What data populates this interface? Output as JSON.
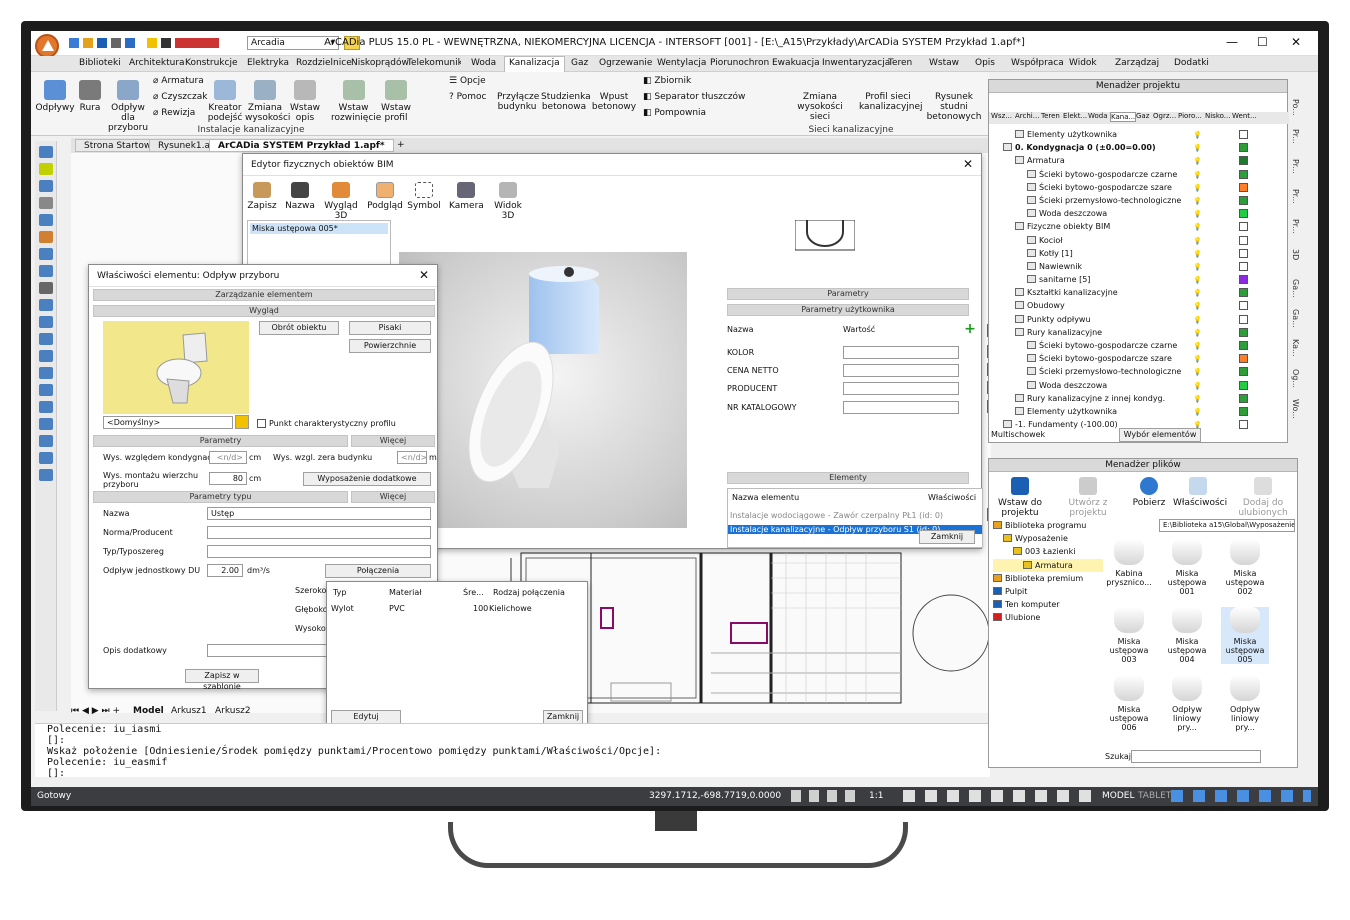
{
  "window": {
    "title": "ArCADia PLUS 15.0 PL - WEWNĘTRZNA, NIEKOMERCYJNA LICENCJA - INTERSOFT [001] - [E:\\_A15\\Przykłady\\ArCADia SYSTEM Przykład 1.apf*]",
    "profile": "Arcadia"
  },
  "menu": [
    "Biblioteki",
    "Architektura",
    "Konstrukcje",
    "Elektryka",
    "Rozdzielnice",
    "Niskoprądów",
    "Telekomunikacja",
    "Woda",
    "Kanalizacja",
    "Gaz",
    "Ogrzewanie",
    "Wentylacja",
    "Piorunochron",
    "Ewakuacja",
    "Inwentaryzacja",
    "Teren",
    "Wstaw",
    "Opis",
    "Współpraca",
    "Widok",
    "Zarządzaj",
    "Dodatki"
  ],
  "ribbon": {
    "buttons": [
      "Odpływy",
      "Rura",
      "Odpływ dla przyboru",
      "Kreator podejść",
      "Zmiana wysokości",
      "Wstaw opis",
      "Wstaw rozwinięcie",
      "Wstaw profil",
      "Przyłącze budynku",
      "Studzienka betonowa",
      "Wpust betonowy",
      "Zmiana wysokości sieci",
      "Profil sieci kanalizacyjnej",
      "Rysunek studni betonowych"
    ],
    "small": [
      "Armatura",
      "Czyszczak",
      "Rewizja",
      "Opcje",
      "Pomoc",
      "Zbiornik",
      "Separator tłuszczów",
      "Pompownia"
    ],
    "groups": [
      "Instalacje kanalizacyjne",
      "Sieci kanalizacyjne"
    ]
  },
  "doc_tabs": [
    "Strona Startowa",
    "Rysunek1.apf",
    "ArCADia SYSTEM Przykład 1.apf*"
  ],
  "bim_editor": {
    "title": "Edytor fizycznych obiektów BIM",
    "toolbar": [
      "Zapisz",
      "Nazwa",
      "Wygląd 3D",
      "Podgląd",
      "Symbol",
      "Kamera",
      "Widok 3D"
    ],
    "list_item": "Miska ustępowa 005*",
    "sections": {
      "params": "Parametry",
      "user_params": "Parametry użytkownika",
      "elements": "Elementy"
    },
    "cols": {
      "name": "Nazwa",
      "value": "Wartość"
    },
    "user_rows": [
      "KOLOR",
      "CENA NETTO",
      "PRODUCENT",
      "NR KATALOGOWY"
    ],
    "elem_cols": {
      "name": "Nazwa elementu",
      "props": "Właściwości"
    },
    "elements": [
      "Instalacje wodociągowe - Zawór czerpalny PŁ1 (id: 0)",
      "Instalacje kanalizacyjne - Odpływ przyboru S1 (id: 0)"
    ],
    "close": "Zamknij"
  },
  "props": {
    "title": "Właściwości elementu: Odpływ przyboru",
    "sections": [
      "Zarządzanie elementem",
      "Wygląd",
      "Parametry",
      "Parametry typu"
    ],
    "more": "Więcej",
    "rotate": "Obrót obiektu",
    "pens": "Pisaki",
    "surfaces": "Powierzchnie",
    "default": "<Domyślny>",
    "char_point": "Punkt charakterystyczny profilu",
    "h_level": "Wys. względem kondygnacji",
    "h_level_val": "<n/d>",
    "unit": "cm",
    "h_zero": "Wys. wzgl. zera budynku",
    "h_zero_val": "<n/d>",
    "unit_m": "m",
    "h_mount": "Wys. montażu wierzchu przyboru",
    "h_mount_val": "80",
    "extra": "Wyposażenie dodatkowe",
    "name_lbl": "Nazwa",
    "name_val": "Ustęp",
    "norm": "Norma/Producent",
    "type": "Typ/Typoszereg",
    "du": "Odpływ jednostkowy DU",
    "du_val": "2.00",
    "du_unit": "dm³/s",
    "conn": "Połączenia",
    "width": "Szeroko",
    "depth": "Głęboko",
    "height": "Wysoko",
    "desc": "Opis dodatkowy",
    "save_tpl": "Zapisz w szablonie"
  },
  "conn_popup": {
    "cols": [
      "Typ",
      "Materiał",
      "Śre...",
      "Rodzaj połączenia"
    ],
    "row": [
      "Wylot",
      "PVC",
      "100",
      "Kielichowe"
    ],
    "edit": "Edytuj",
    "close": "Zamknij"
  },
  "sheets": [
    "Model",
    "Arkusz1",
    "Arkusz2"
  ],
  "command": [
    "Polecenie: iu_iasmi",
    "  []:",
    "Wskaż położenie [Odniesienie/Środek pomiędzy punktami/Procentowo pomiędzy punktami/Właściwości/Opcje]:",
    "Polecenie: iu_easmif",
    "  []:"
  ],
  "status": {
    "left": "Gotowy",
    "coords": "3297.1712,-698.7719,0.0000",
    "scale": "1:1",
    "model": "MODEL",
    "tablet": "TABLET"
  },
  "project_mgr": {
    "title": "Menadżer projektu",
    "tabs": [
      "Wsz...",
      "Archi...",
      "Teren",
      "Elekt...",
      "Woda",
      "Kana...",
      "Gaz",
      "Ogrz...",
      "Pioro...",
      "Nisko...",
      "Went..."
    ],
    "tree": [
      "Elementy użytkownika",
      "0. Kondygnacja 0 (±0.00=0.00)",
      "Armatura",
      "Ścieki bytowo-gospodarcze czarne",
      "Ścieki bytowo-gospodarcze szare",
      "Ścieki przemysłowo-technologiczne",
      "Woda deszczowa",
      "Fizyczne obiekty BIM",
      "Kocioł",
      "Kotły [1]",
      "Nawiewnik",
      "sanitarne [5]",
      "Kształtki kanalizacyjne",
      "Obudowy",
      "Punkty odpływu",
      "Rury kanalizacyjne",
      "Ścieki bytowo-gospodarcze czarne",
      "Ścieki bytowo-gospodarcze szare",
      "Ścieki przemysłowo-technologiczne",
      "Woda deszczowa",
      "Rury kanalizacyjne z innej kondyg.",
      "Elementy użytkownika",
      "-1. Fundamenty (-100.00)"
    ],
    "swatches": [
      "#ffffff",
      "#2e9e3a",
      "#1e7a2e",
      "#2e9e3a",
      "#ff7f27",
      "#2e9e3a",
      "#22cc44",
      "#ffffff",
      "#ffffff",
      "#ffffff",
      "#ffffff",
      "#8a2be2",
      "#2e9e3a",
      "#ffffff",
      "#ffffff",
      "#2e9e3a",
      "#2e9e3a",
      "#ff7f27",
      "#2e9e3a",
      "#22cc44",
      "#2e9e3a",
      "#2e9e3a",
      "#ffffff"
    ],
    "multi": "Multischowek",
    "select": "Wybór elementów"
  },
  "side_tabs": [
    "Po...",
    "Pr...",
    "Pr...",
    "Pr...",
    "Pr...",
    "3D",
    "Ga...",
    "Ga...",
    "Ka...",
    "Og...",
    "Wo..."
  ],
  "file_mgr": {
    "title": "Menadżer plików",
    "tools": [
      "Wstaw do projektu",
      "Utwórz z projektu",
      "Pobierz",
      "Właściwości",
      "Dodaj do ulubionych"
    ],
    "path": "E:\\Biblioteka a15\\Global\\Wyposażenie",
    "tree": [
      "Biblioteka programu",
      "Wyposażenie",
      "003 Łazienki",
      "Armatura",
      "Biblioteka premium",
      "Pulpit",
      "Ten komputer",
      "Ulubione"
    ],
    "items": [
      "Kabina prysznico...",
      "Miska ustępowa 001",
      "Miska ustępowa 002",
      "Miska ustępowa 003",
      "Miska ustępowa 004",
      "Miska ustępowa 005",
      "Miska ustępowa 006",
      "Odpływ liniowy pry...",
      "Odpływ liniowy pry..."
    ],
    "search": "Szukaj:"
  }
}
